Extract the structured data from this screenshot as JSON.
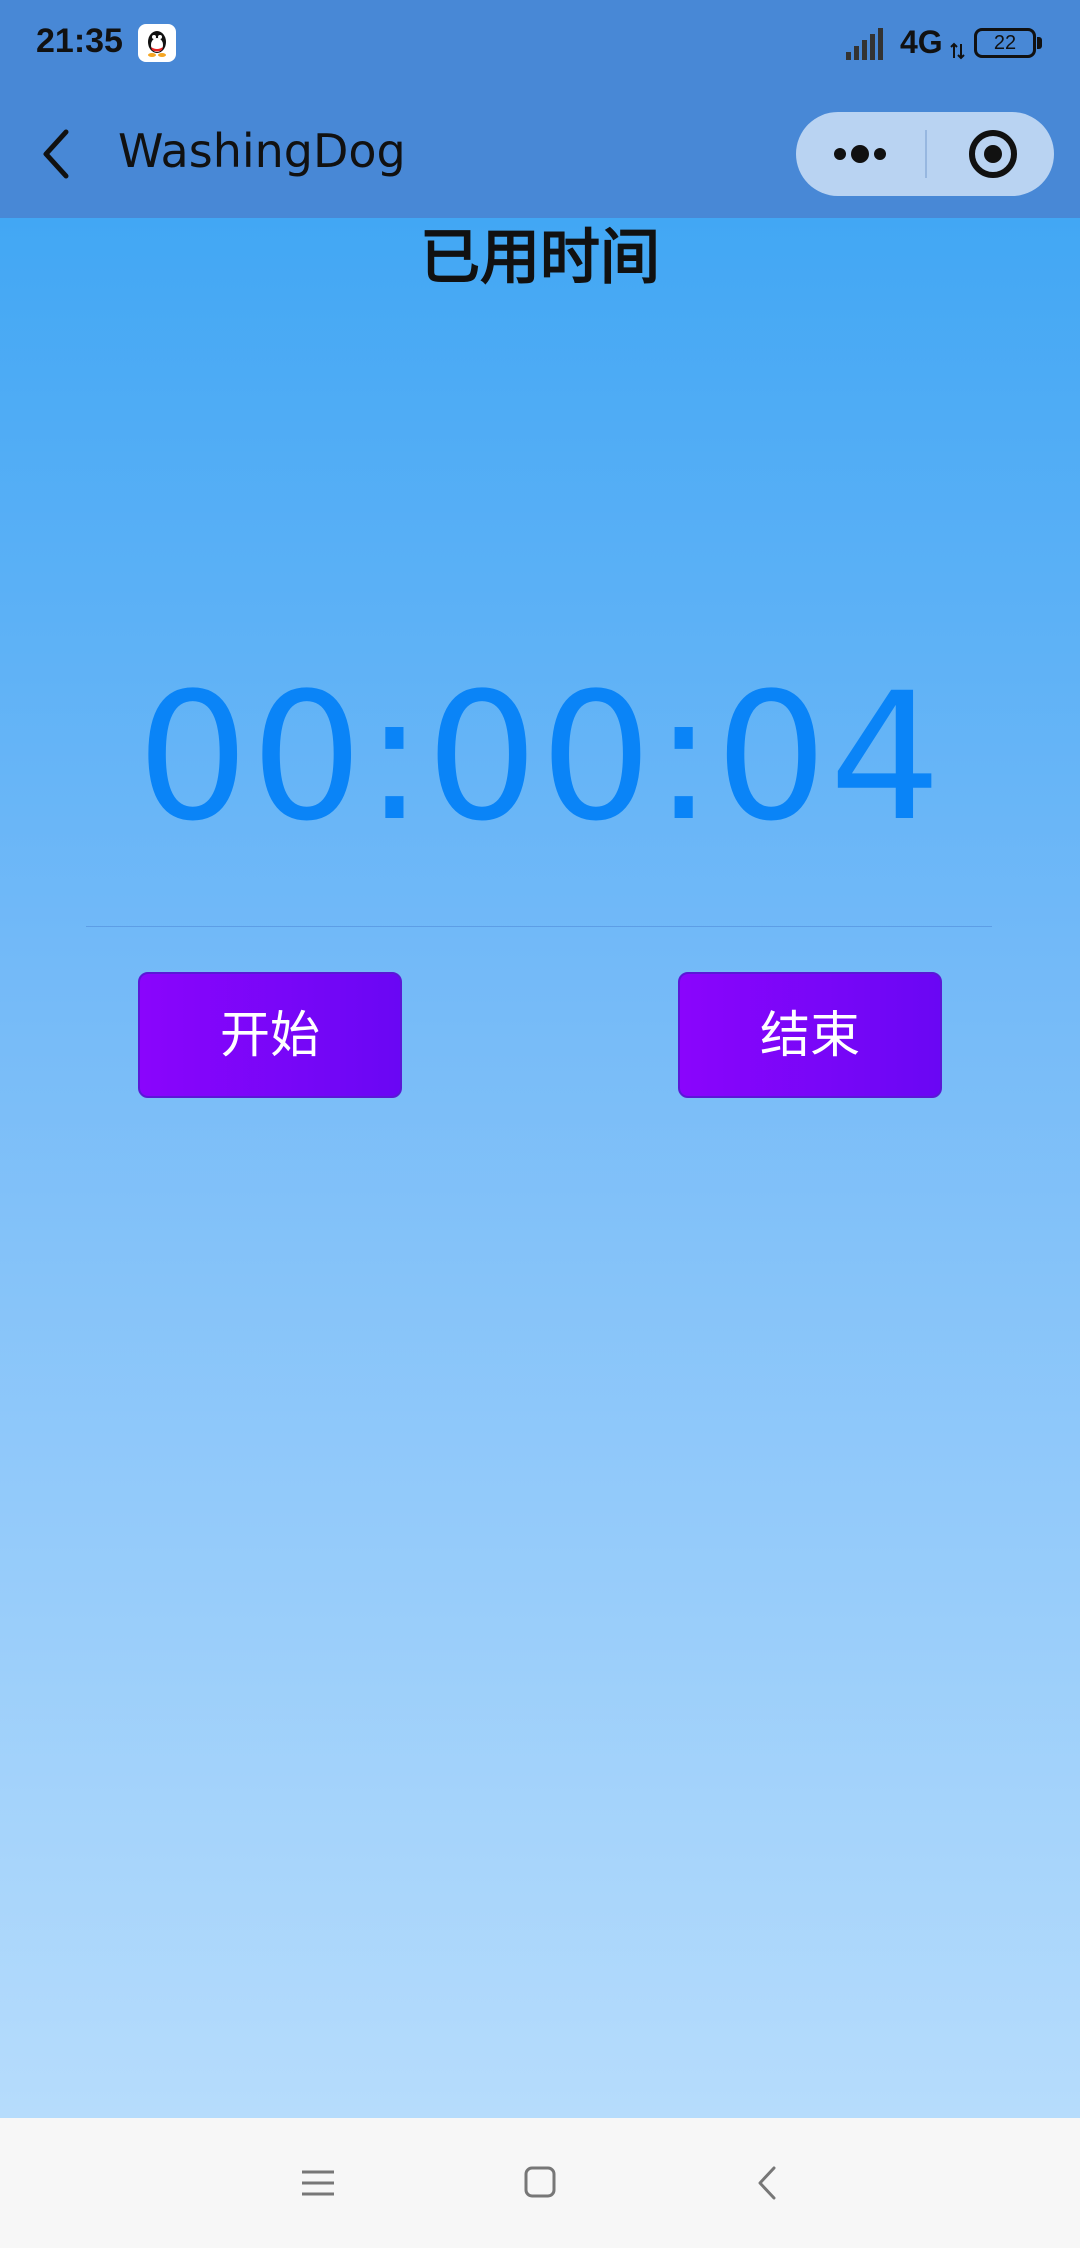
{
  "status_bar": {
    "time": "21:35",
    "network": "4G",
    "battery": "22",
    "icons": [
      "qq-icon",
      "signal-icon",
      "network-arrows-icon",
      "battery-icon"
    ]
  },
  "nav_bar": {
    "title": "WashingDog",
    "back_icon": "chevron-left-icon",
    "more_icon": "more-dots-icon",
    "close_icon": "target-circle-icon"
  },
  "main": {
    "elapsed_label": "已用时间",
    "timer": "00:00:04",
    "start_label": "开始",
    "stop_label": "结束"
  },
  "system_nav": {
    "icons": [
      "menu-icon",
      "home-icon",
      "back-icon"
    ]
  },
  "colors": {
    "header_bg": "#4888d6",
    "timer": "#0a84f7",
    "button_bg": "#8a05fc",
    "gradient_top": "#42a7f4",
    "gradient_bottom": "#b6dcfc"
  }
}
